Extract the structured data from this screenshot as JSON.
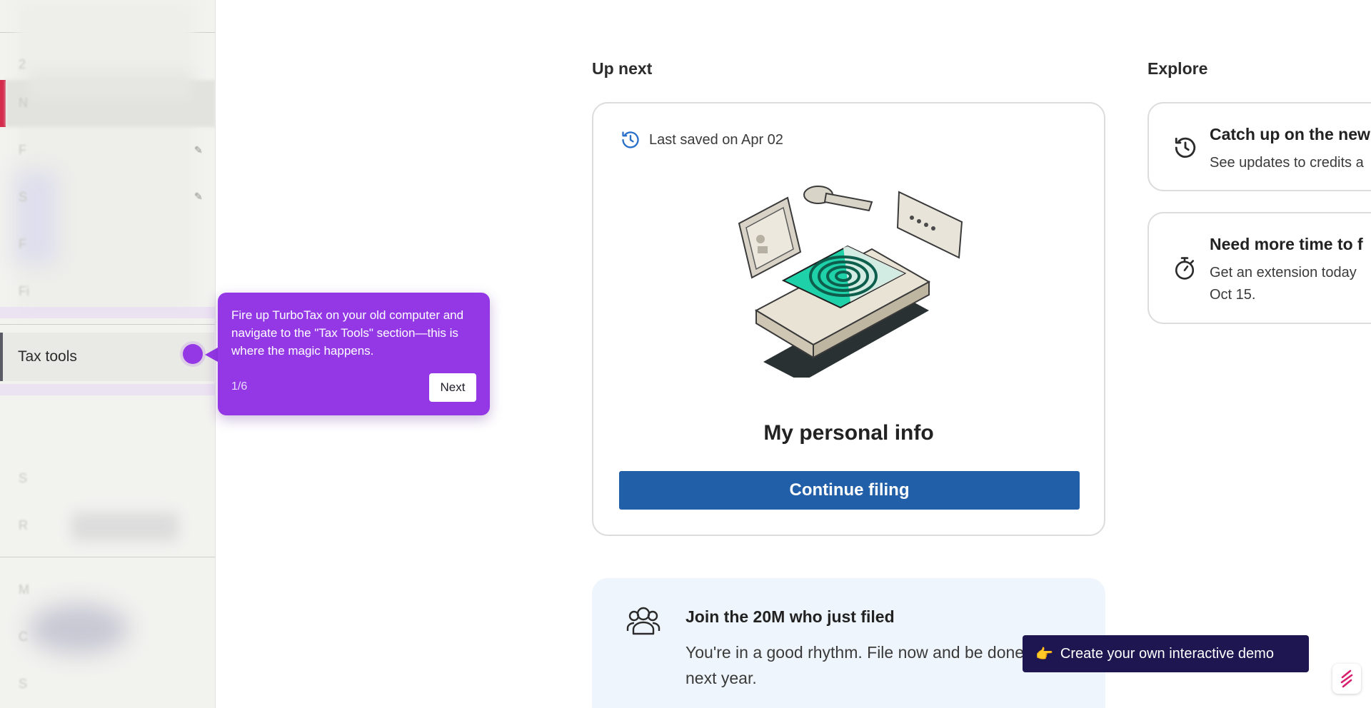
{
  "sidebar": {
    "active_item_label": "Tax tools"
  },
  "tour": {
    "text": "Fire up TurboTax on your old computer and navigate to the \"Tax Tools\" section—this is where the magic happens.",
    "step": "1/6",
    "next_label": "Next"
  },
  "main": {
    "up_next_heading": "Up next",
    "explore_heading": "Explore",
    "card": {
      "saved_text": "Last saved on Apr 02",
      "title": "My personal info",
      "cta_label": "Continue filing"
    },
    "join": {
      "title": "Join the 20M who just filed",
      "body": "You're in a good rhythm. File now and be done until next year."
    },
    "explore_cards": [
      {
        "title": "Catch up on the new",
        "body": "See updates to credits a"
      },
      {
        "title": "Need more time to f",
        "body_line1": "Get an extension today",
        "body_line2": "Oct 15."
      }
    ]
  },
  "demo": {
    "emoji": "👉",
    "label": "Create your own interactive demo"
  },
  "colors": {
    "tour_purple": "#9438e6",
    "primary_blue": "#215fa8",
    "demo_navy": "#1d1650",
    "sidebar_accent": "#d52b4d"
  },
  "icons": [
    "history-icon",
    "fingerprint-phone-illustration",
    "people-icon",
    "stopwatch-icon",
    "storylane-logo-icon"
  ]
}
